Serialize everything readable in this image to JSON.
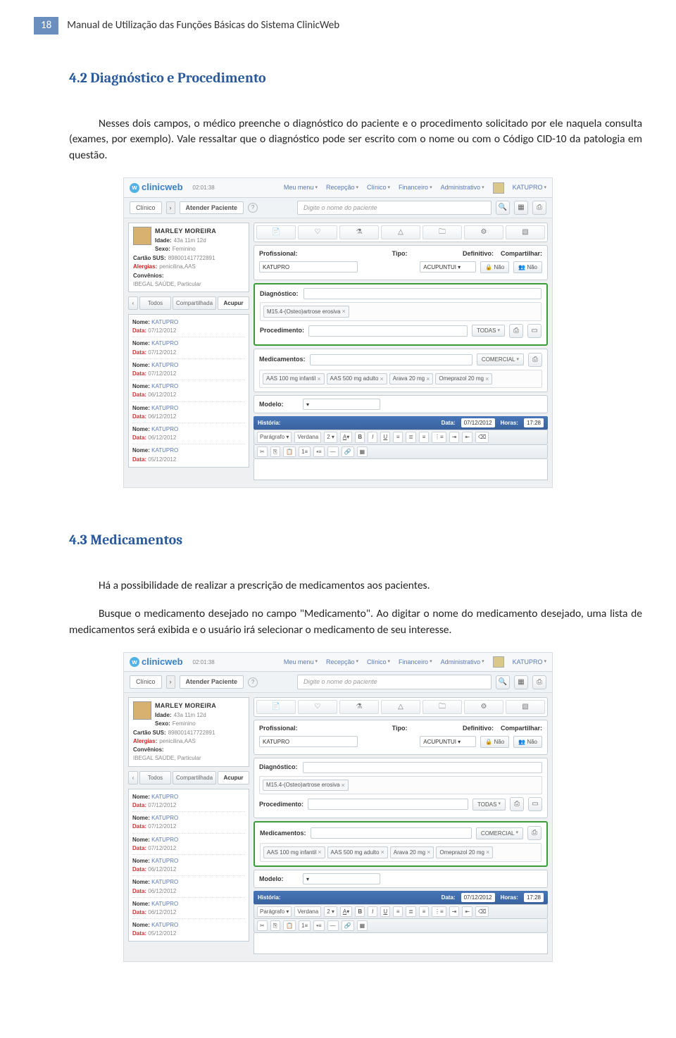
{
  "page": {
    "number": "18",
    "header_title": "Manual de Utilização das Funções Básicas do Sistema ClinicWeb"
  },
  "section42": {
    "heading": "4.2    Diagnóstico e Procedimento",
    "para": "Nesses dois campos, o médico preenche o diagnóstico do paciente e o procedimento solicitado por ele naquela consulta (exames, por exemplo). Vale ressaltar que o diagnóstico pode ser escrito com o nome ou com o Código CID-10 da patologia em questão."
  },
  "section43": {
    "heading": "4.3    Medicamentos",
    "para1": "Há a possibilidade de realizar a prescrição de medicamentos aos pacientes.",
    "para2": "Busque o medicamento desejado no campo \"Medicamento\". Ao digitar o nome do medicamento desejado, uma lista de medicamentos será exibida e o usuário irá selecionar o medicamento de seu interesse."
  },
  "app": {
    "logo_text": "clinicweb",
    "time": "02:01:38",
    "menus": [
      "Meu menu",
      "Recepção",
      "Clínico",
      "Financeiro",
      "Administrativo"
    ],
    "user": "KATUPRO",
    "breadcrumb": {
      "a": "Clínico",
      "b": "Atender Paciente"
    },
    "search_placeholder": "Digite o nome do paciente",
    "patient": {
      "name": "MARLEY MOREIRA",
      "idade_lbl": "Idade:",
      "idade": "43a 11m 12d",
      "sexo_lbl": "Sexo:",
      "sexo": "Feminino",
      "cartao_lbl": "Cartão SUS:",
      "cartao": "898001417722891",
      "alergias_lbl": "Alergias:",
      "alergias": "penicilina,AAS",
      "conv_lbl": "Convênios:",
      "conv": "IBEGAL SAÚDE, Particular"
    },
    "tabs": {
      "todos": "Todos",
      "comp": "Compartilhada",
      "acup": "Acupur"
    },
    "hist_items": [
      {
        "nome": "KATUPRO",
        "data": "07/12/2012"
      },
      {
        "nome": "KATUPRO",
        "data": "07/12/2012"
      },
      {
        "nome": "KATUPRO",
        "data": "07/12/2012"
      },
      {
        "nome": "KATUPRO",
        "data": "06/12/2012"
      },
      {
        "nome": "KATUPRO",
        "data": "06/12/2012"
      },
      {
        "nome": "KATUPRO",
        "data": "06/12/2012"
      },
      {
        "nome": "KATUPRO",
        "data": "05/12/2012"
      }
    ],
    "form": {
      "profissional_lbl": "Profissional:",
      "profissional": "KATUPRO",
      "tipo_lbl": "Tipo:",
      "tipo": "ACUPUNTUI",
      "definitivo_lbl": "Definitivo:",
      "compartilhar_lbl": "Compartilhar:",
      "nao": "Não",
      "diagnostico_lbl": "Diagnóstico:",
      "diagnostico_chip": "M15.4-(Osteo)artrose erosiva",
      "procedimento_lbl": "Procedimento:",
      "todas": "TODAS",
      "medicamentos_lbl": "Medicamentos:",
      "comercial": "COMERCIAL",
      "med_chips": [
        "AAS 100 mg infantil",
        "AAS 500 mg adulto",
        "Arava 20 mg",
        "Omeprazol 20 mg"
      ],
      "modelo_lbl": "Modelo:",
      "historia_lbl": "História:",
      "data_lbl": "Data:",
      "data_val": "07/12/2012",
      "horas_lbl": "Horas:",
      "horas_val": "17:28",
      "paragrafo": "Parágrafo",
      "verdana": "Verdana"
    }
  }
}
